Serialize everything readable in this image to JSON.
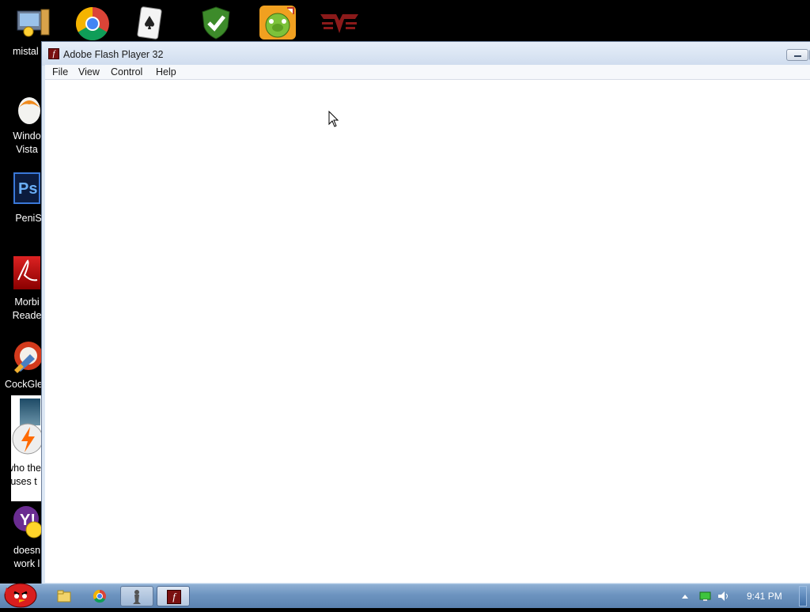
{
  "desktop": {
    "top_icons": [
      "computer",
      "chrome",
      "solitaire",
      "security-shield",
      "bad-piggies",
      "papers-please"
    ],
    "left_icons": [
      {
        "label": "mistal"
      },
      {
        "label": "Windo\nVista"
      },
      {
        "label": "PeniS"
      },
      {
        "label": "Morbi\nReade"
      },
      {
        "label": "CockGle"
      },
      {
        "label": "who the\nuses t"
      },
      {
        "label": "doesn\nwork l"
      }
    ]
  },
  "window": {
    "title": "Adobe Flash Player 32",
    "menu": [
      "File",
      "View",
      "Control",
      "Help"
    ]
  },
  "taskbar": {
    "clock": "9:41 PM",
    "apps": [
      "explorer",
      "chrome",
      "chess-piece",
      "flash-player"
    ]
  }
}
